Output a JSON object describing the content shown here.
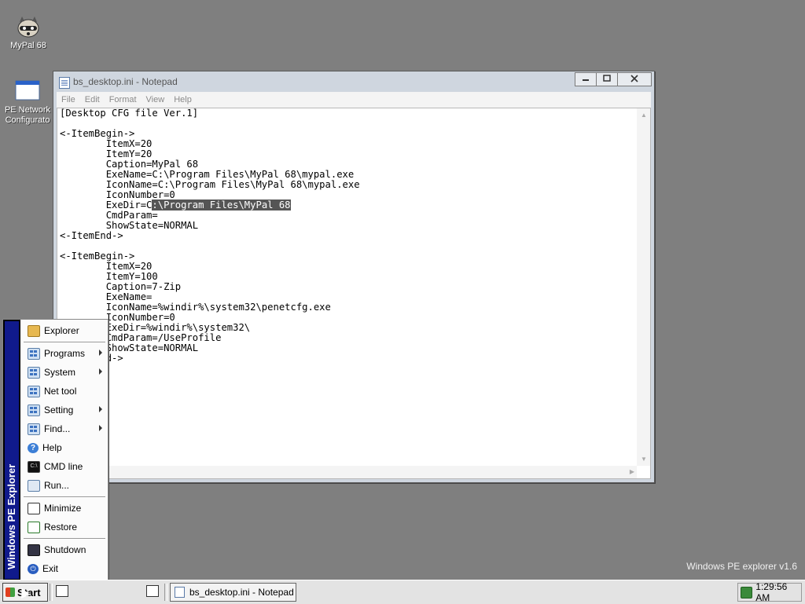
{
  "desktop": {
    "icons": [
      {
        "label": "MyPal 68",
        "icon": "raccoon-icon"
      },
      {
        "label": "PE Network Configurato",
        "icon": "window-icon"
      }
    ],
    "brand_text": "Windows PE explorer v1.6"
  },
  "notepad": {
    "title": "bs_desktop.ini - Notepad",
    "menu": [
      "File",
      "Edit",
      "Format",
      "View",
      "Help"
    ],
    "controls": {
      "minimize": "minimize-icon",
      "maximize": "maximize-icon",
      "close": "close-icon"
    },
    "content_before_selection": "[Desktop CFG file Ver.1]\n\n<-ItemBegin->\n        ItemX=20\n        ItemY=20\n        Caption=MyPal 68\n        ExeName=C:\\Program Files\\MyPal 68\\mypal.exe\n        IconName=C:\\Program Files\\MyPal 68\\mypal.exe\n        IconNumber=0\n        ExeDir=C",
    "selected_text": ":\\Program Files\\MyPal 68",
    "content_after_selection": "\n        CmdParam=\n        ShowState=NORMAL\n<-ItemEnd->\n\n<-ItemBegin->\n        ItemX=20\n        ItemY=100\n        Caption=7-Zip\n        ExeName=\n        IconName=%windir%\\system32\\penetcfg.exe\n        IconNumber=0\n        ExeDir=%windir%\\system32\\\n        CmdParam=/UseProfile\n        ShowState=NORMAL\n<-ItemEnd->"
  },
  "start_menu": {
    "sidebar_label": "Windows PE  Explorer",
    "items": [
      {
        "label": "Explorer",
        "icon": "folder-icon",
        "submenu": false
      },
      {
        "label": "Programs",
        "icon": "programs-icon",
        "submenu": true
      },
      {
        "label": "System",
        "icon": "system-icon",
        "submenu": true
      },
      {
        "label": "Net tool",
        "icon": "net-tool-icon",
        "submenu": false
      },
      {
        "label": "Setting",
        "icon": "setting-icon",
        "submenu": true
      },
      {
        "label": "Find...",
        "icon": "find-icon",
        "submenu": true
      },
      {
        "label": "Help",
        "icon": "help-icon",
        "submenu": false
      },
      {
        "label": "CMD line",
        "icon": "cmd-icon",
        "submenu": false
      },
      {
        "label": "Run...",
        "icon": "run-icon",
        "submenu": false
      },
      {
        "label": "Minimize",
        "icon": "minimize-all-icon",
        "submenu": false
      },
      {
        "label": "Restore",
        "icon": "restore-icon",
        "submenu": false
      },
      {
        "label": "Shutdown",
        "icon": "shutdown-icon",
        "submenu": false
      },
      {
        "label": "Exit",
        "icon": "exit-icon",
        "submenu": false
      }
    ]
  },
  "taskbar": {
    "start_label": "Start",
    "task_label": "bs_desktop.ini - Notepad",
    "clock": "1:29:56 AM"
  }
}
